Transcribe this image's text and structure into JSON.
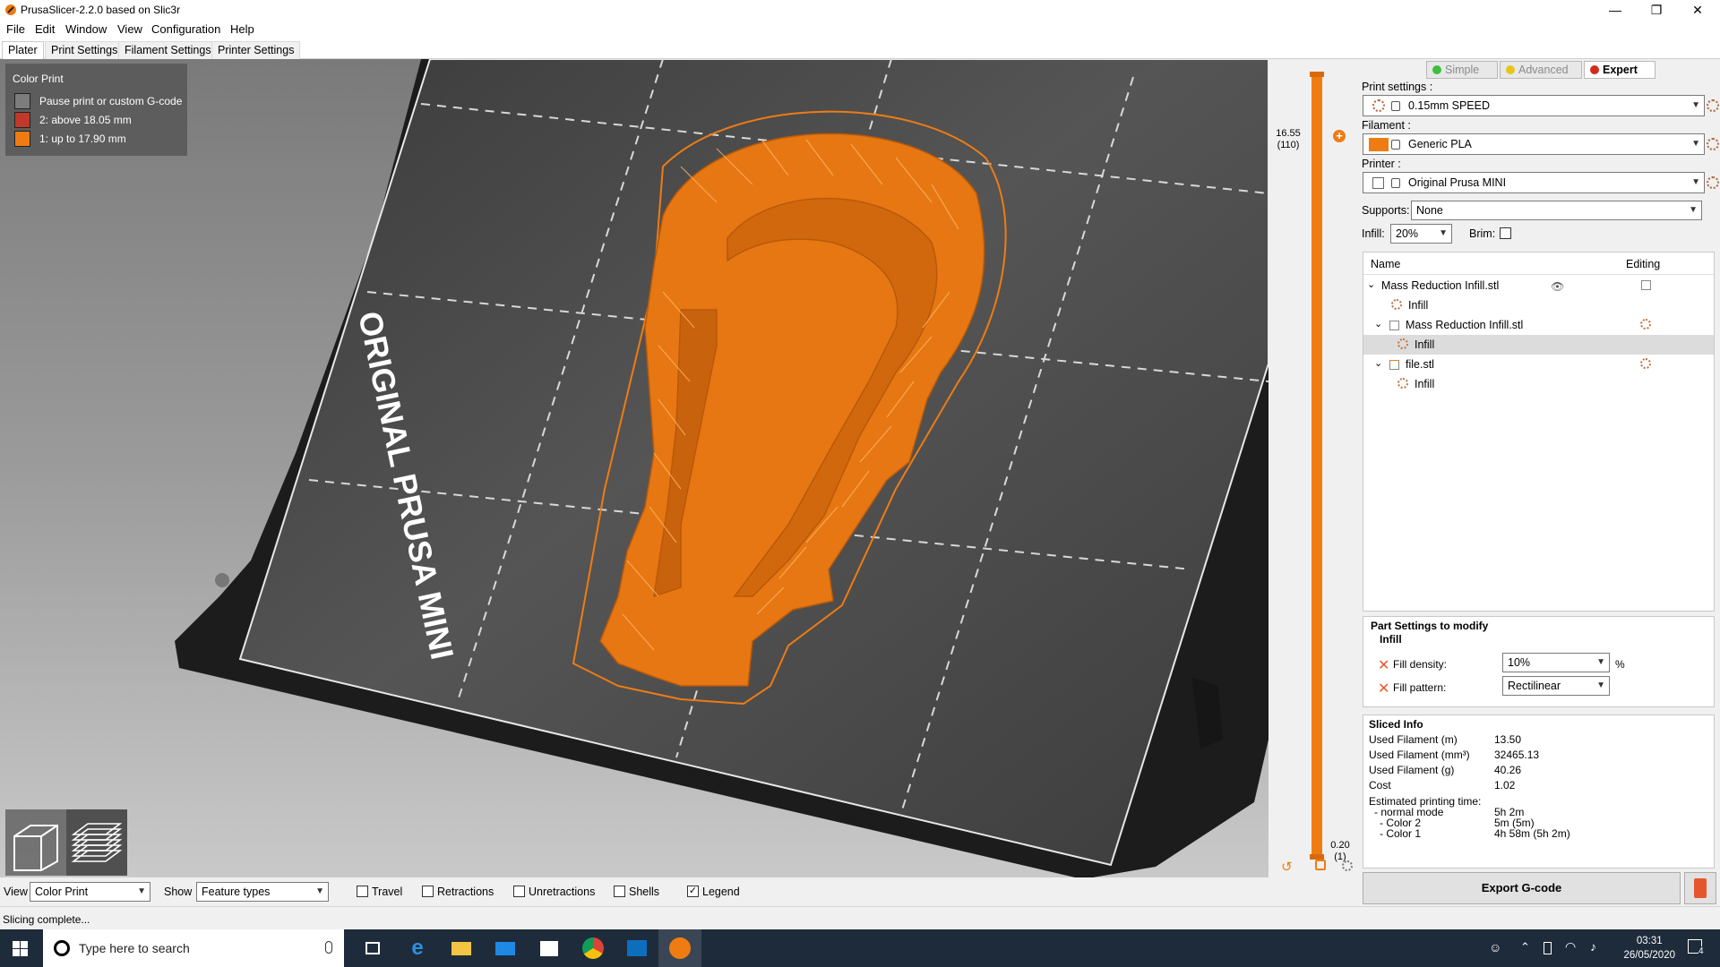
{
  "window": {
    "title": "PrusaSlicer-2.2.0 based on Slic3r",
    "controls": [
      "—",
      "❐",
      "✕"
    ]
  },
  "menu": [
    "File",
    "Edit",
    "Window",
    "View",
    "Configuration",
    "Help"
  ],
  "tabs": [
    "Plater",
    "Print Settings",
    "Filament Settings",
    "Printer Settings"
  ],
  "legend": {
    "title": "Color Print",
    "items": [
      {
        "label": "Pause print or custom G-code",
        "color": "#7d7d7d"
      },
      {
        "label": "2: above 18.05 mm",
        "color": "#c0392b"
      },
      {
        "label": "1: up to 17.90 mm",
        "color": "#ef7c13"
      }
    ]
  },
  "bed_label": "ORIGINAL PRUSA MINI",
  "layer_slider": {
    "top_value": "16.55",
    "top_layer": "(110)",
    "bottom_value": "0.20",
    "bottom_layer": "(1)"
  },
  "bottom_toolbar": {
    "view_label": "View",
    "view_value": "Color Print",
    "show_label": "Show",
    "show_value": "Feature types",
    "checkboxes": [
      {
        "label": "Travel",
        "checked": false
      },
      {
        "label": "Retractions",
        "checked": false
      },
      {
        "label": "Unretractions",
        "checked": false
      },
      {
        "label": "Shells",
        "checked": false
      },
      {
        "label": "Legend",
        "checked": true
      }
    ]
  },
  "status": "Slicing complete...",
  "modes": [
    {
      "label": "Simple",
      "color": "#3fbf3f",
      "active": false
    },
    {
      "label": "Advanced",
      "color": "#e6c619",
      "active": false
    },
    {
      "label": "Expert",
      "color": "#d42a1e",
      "active": true
    }
  ],
  "settings": {
    "print_label": "Print settings :",
    "print_value": "0.15mm SPEED",
    "filament_label": "Filament :",
    "filament_value": "Generic PLA",
    "filament_color": "#ef7c13",
    "printer_label": "Printer :",
    "printer_value": "Original Prusa MINI",
    "supports_label": "Supports:",
    "supports_value": "None",
    "infill_label": "Infill:",
    "infill_value": "20%",
    "brim_label": "Brim:"
  },
  "object_list": {
    "col_name": "Name",
    "col_editing": "Editing",
    "rows": [
      {
        "label": "Mass Reduction Infill.stl",
        "level": 0,
        "expander": "⌄"
      },
      {
        "label": "Infill",
        "level": 1,
        "expander": ""
      },
      {
        "label": "Mass Reduction Infill.stl",
        "level": 1,
        "expander": "⌄"
      },
      {
        "label": "Infill",
        "level": 2,
        "expander": ""
      },
      {
        "label": "file.stl",
        "level": 1,
        "expander": "⌄"
      },
      {
        "label": "Infill",
        "level": 2,
        "expander": ""
      }
    ]
  },
  "part_settings": {
    "title": "Part Settings to modify",
    "group": "Infill",
    "fill_density_label": "Fill density:",
    "fill_density_value": "10%",
    "fill_density_unit": "%",
    "fill_pattern_label": "Fill pattern:",
    "fill_pattern_value": "Rectilinear"
  },
  "sliced_info": {
    "title": "Sliced Info",
    "rows": [
      {
        "k": "Used Filament (m)",
        "v": "13.50"
      },
      {
        "k": "Used Filament (mm³)",
        "v": "32465.13"
      },
      {
        "k": "Used Filament (g)",
        "v": "40.26"
      },
      {
        "k": "Cost",
        "v": "1.02"
      }
    ],
    "time_title": "Estimated printing time:",
    "time_rows": [
      {
        "k": "- normal mode",
        "v": "5h 2m"
      },
      {
        "k": "- Color 2",
        "v": "5m (5m)"
      },
      {
        "k": "- Color 1",
        "v": "4h 58m (5h 2m)"
      }
    ]
  },
  "export_label": "Export G-code",
  "taskbar": {
    "search_placeholder": "Type here to search",
    "time": "03:31",
    "date": "26/05/2020",
    "notif_count": "4"
  }
}
